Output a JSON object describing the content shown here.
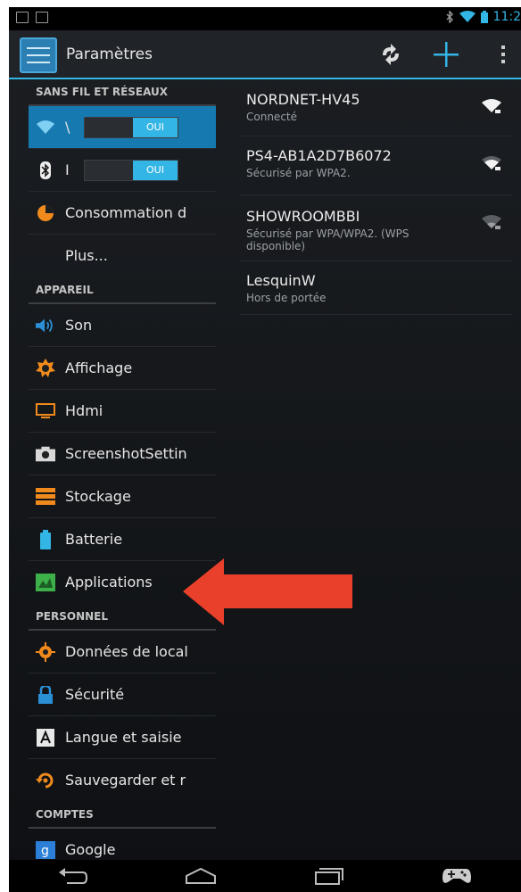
{
  "actionbar": {
    "title": "Paramètres"
  },
  "status": {
    "time": "11:2"
  },
  "sections": {
    "wireless": "SANS FIL ET RÉSEAUX",
    "device": "APPAREIL",
    "personal": "PERSONNEL",
    "accounts": "COMPTES"
  },
  "wireless_items": [
    {
      "label": "\\",
      "toggle": "OUI",
      "icon": "wifi-icon"
    },
    {
      "label": "I",
      "toggle": "OUI",
      "icon": "bluetooth-icon"
    },
    {
      "label": "Consommation d",
      "icon": "data-usage-icon"
    },
    {
      "label": "Plus...",
      "icon": ""
    }
  ],
  "device_items": [
    {
      "label": "Son",
      "icon": "speaker-icon"
    },
    {
      "label": "Affichage",
      "icon": "brightness-icon"
    },
    {
      "label": "Hdmi",
      "icon": "monitor-icon"
    },
    {
      "label": "ScreenshotSettin",
      "icon": "camera-icon"
    },
    {
      "label": "Stockage",
      "icon": "storage-icon"
    },
    {
      "label": "Batterie",
      "icon": "battery-icon"
    },
    {
      "label": "Applications",
      "icon": "applications-icon"
    }
  ],
  "personal_items": [
    {
      "label": "Données de local",
      "icon": "location-icon"
    },
    {
      "label": "Sécurité",
      "icon": "lock-icon"
    },
    {
      "label": "Langue et saisie",
      "icon": "language-icon"
    },
    {
      "label": "Sauvegarder et r",
      "icon": "backup-icon"
    }
  ],
  "account_items": [
    {
      "label": "Google",
      "icon": "google-icon"
    }
  ],
  "networks": [
    {
      "name": "NORDNET-HV45",
      "status": "Connecté"
    },
    {
      "name": "PS4-AB1A2D7B6072",
      "status": "Sécurisé par WPA2."
    },
    {
      "name": "SHOWROOMBBI",
      "status": "Sécurisé par WPA/WPA2. (WPS disponible)"
    },
    {
      "name": "LesquinW",
      "status": "Hors de portée"
    }
  ],
  "colors": {
    "accent": "#33b5e5",
    "arrow": "#e8402a"
  }
}
